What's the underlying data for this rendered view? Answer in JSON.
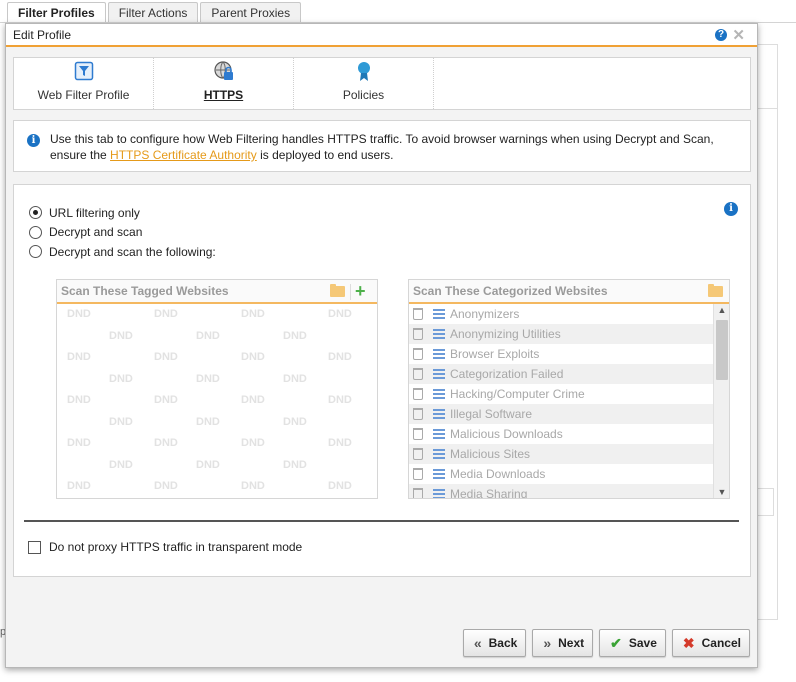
{
  "background": {
    "tabs": [
      {
        "label": "Filter Profiles",
        "active": true
      },
      {
        "label": "Filter Actions",
        "active": false
      },
      {
        "label": "Parent Proxies",
        "active": false
      }
    ],
    "stray_text": "p"
  },
  "dialog": {
    "title": "Edit Profile",
    "help_icon": "?",
    "close_icon": "✕"
  },
  "tabs": [
    {
      "label": "Web Filter Profile",
      "icon": "filter-icon",
      "active": false
    },
    {
      "label": "HTTPS",
      "icon": "globe-lock-icon",
      "active": true
    },
    {
      "label": "Policies",
      "icon": "ribbon-icon",
      "active": false
    }
  ],
  "info": {
    "text_before": "Use this tab to configure how Web Filtering handles HTTPS traffic. To avoid browser warnings when using Decrypt and Scan, ensure the ",
    "link_text": "HTTPS Certificate Authority",
    "text_after": " is deployed to end users."
  },
  "mode": {
    "options": [
      {
        "label": "URL filtering only",
        "selected": true
      },
      {
        "label": "Decrypt and scan",
        "selected": false
      },
      {
        "label": "Decrypt and scan the following:",
        "selected": false
      }
    ]
  },
  "tagged_panel": {
    "title": "Scan These Tagged Websites",
    "placeholder": "DND"
  },
  "categorized_panel": {
    "title": "Scan These Categorized Websites",
    "items": [
      "Anonymizers",
      "Anonymizing Utilities",
      "Browser Exploits",
      "Categorization Failed",
      "Hacking/Computer Crime",
      "Illegal Software",
      "Malicious Downloads",
      "Malicious Sites",
      "Media Downloads",
      "Media Sharing"
    ]
  },
  "transparent": {
    "label": "Do not proxy HTTPS traffic in transparent mode",
    "checked": false
  },
  "buttons": {
    "back": "Back",
    "next": "Next",
    "save": "Save",
    "cancel": "Cancel"
  },
  "colors": {
    "accent": "#f0a135",
    "info_blue": "#1a72c4",
    "link": "#e59a1a",
    "save_check": "#3aa335",
    "cancel_x": "#d43a2a"
  }
}
